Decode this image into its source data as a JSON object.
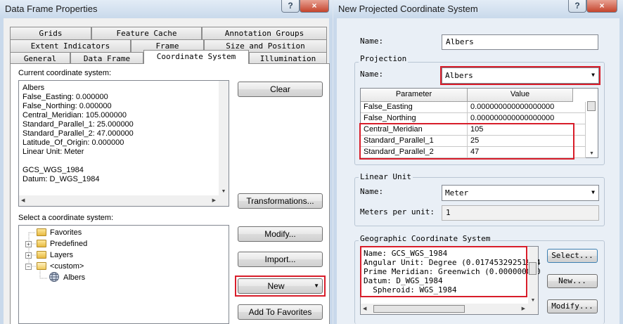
{
  "left_window": {
    "title": "Data Frame Properties",
    "help_btn": "?",
    "close_btn": "×",
    "tabs_row1": [
      "Grids",
      "Feature Cache",
      "Annotation Groups"
    ],
    "tabs_row2": [
      "Extent Indicators",
      "Frame",
      "Size and Position"
    ],
    "tabs_row3": [
      "General",
      "Data Frame",
      "Coordinate System",
      "Illumination"
    ],
    "current_label": "Current coordinate system:",
    "current_lines": [
      "Albers",
      "False_Easting: 0.000000",
      "False_Northing: 0.000000",
      "Central_Meridian: 105.000000",
      "Standard_Parallel_1: 25.000000",
      "Standard_Parallel_2: 47.000000",
      "Latitude_Of_Origin: 0.000000",
      "Linear Unit: Meter",
      "",
      "GCS_WGS_1984",
      "Datum: D_WGS_1984"
    ],
    "clear_btn": "Clear",
    "transformations_btn": "Transformations...",
    "select_label": "Select a coordinate system:",
    "tree": [
      "Favorites",
      "Predefined",
      "Layers",
      "<custom>",
      "Albers"
    ],
    "modify_btn": "Modify...",
    "import_btn": "Import...",
    "new_btn": "New",
    "add_fav_btn": "Add To Favorites"
  },
  "right_window": {
    "title": "New Projected Coordinate System",
    "help_btn": "?",
    "close_btn": "×",
    "name_label": "Name:",
    "name_value": "Albers",
    "projection_group": "Projection",
    "proj_name_label": "Name:",
    "proj_name_value": "Albers",
    "table_headers": [
      "Parameter",
      "Value"
    ],
    "table_rows": [
      {
        "param": "False_Easting",
        "value": "0.000000000000000000"
      },
      {
        "param": "False_Northing",
        "value": "0.000000000000000000"
      },
      {
        "param": "Central_Meridian",
        "value": "105"
      },
      {
        "param": "Standard_Parallel_1",
        "value": "25"
      },
      {
        "param": "Standard_Parallel_2",
        "value": "47"
      }
    ],
    "linear_unit_group": "Linear Unit",
    "unit_name_label": "Name:",
    "unit_name_value": "Meter",
    "meters_label": "Meters per unit:",
    "meters_value": "1",
    "gcs_group": "Geographic Coordinate System",
    "gcs_lines": [
      "Name: GCS_WGS_1984",
      "Angular Unit: Degree (0.01745329251994",
      "Prime Meridian: Greenwich (0.000000000",
      "Datum: D_WGS_1984",
      "  Spheroid: WGS_1984"
    ],
    "select_btn": "Select...",
    "new_btn": "New...",
    "modify_btn": "Modify..."
  },
  "colors": {
    "highlight_red": "#d81d2a",
    "titlebar": "#c9d9eb",
    "window_bg": "#f0f0f0",
    "right_panel_bg": "#e9eff6"
  }
}
